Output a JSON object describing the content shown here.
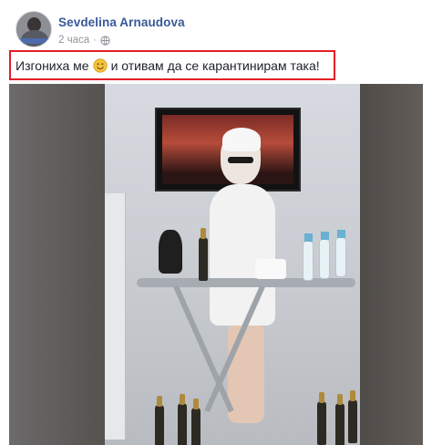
{
  "post": {
    "author": "Sevdelina Arnaudova",
    "time": "2 часа",
    "dot": "·",
    "privacy_icon": "globe-icon",
    "status_before_emoji": "Изгониха ме",
    "status_emoji": "smiley-emoji",
    "status_after_emoji": "и отивам да се карантинирам така!"
  },
  "colors": {
    "author": "#385898",
    "meta": "#90949c",
    "highlight_border": "#e41e26",
    "text": "#1d2129"
  }
}
